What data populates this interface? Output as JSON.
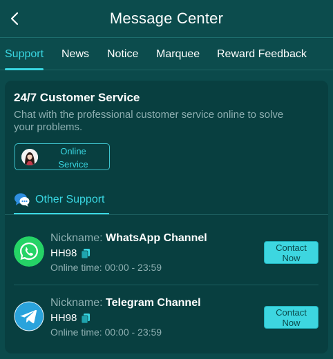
{
  "header": {
    "title": "Message Center",
    "back_icon": "chevron-left-icon"
  },
  "tabs": [
    {
      "label": "Support",
      "active": true
    },
    {
      "label": "News",
      "active": false
    },
    {
      "label": "Notice",
      "active": false
    },
    {
      "label": "Marquee",
      "active": false
    },
    {
      "label": "Reward Feedback",
      "active": false
    }
  ],
  "customer_service": {
    "title": "24/7 Customer Service",
    "description": "Chat with the professional customer service online to solve your problems.",
    "button_line1": "Online",
    "button_line2": "Service",
    "avatar_icon": "agent-avatar"
  },
  "other_support": {
    "label": "Other Support",
    "icon": "chat-bubbles-icon"
  },
  "channels": [
    {
      "nickname_label": "Nickname: ",
      "nickname": "WhatsApp Channel",
      "id": "HH98",
      "time": "Online time: 00:00 - 23:59",
      "contact_line1": "Contact",
      "contact_line2": "Now",
      "icon": "whatsapp-icon",
      "color": "#25d366"
    },
    {
      "nickname_label": "Nickname: ",
      "nickname": "Telegram Channel",
      "id": "HH98",
      "time": "Online time: 00:00 - 23:59",
      "contact_line1": "Contact",
      "contact_line2": "Now",
      "icon": "telegram-icon",
      "color": "#2aa3dc"
    }
  ],
  "colors": {
    "background": "#0b4a4b",
    "card": "#083f40",
    "accent": "#39d7e2",
    "muted_text": "#8fb0b2"
  }
}
